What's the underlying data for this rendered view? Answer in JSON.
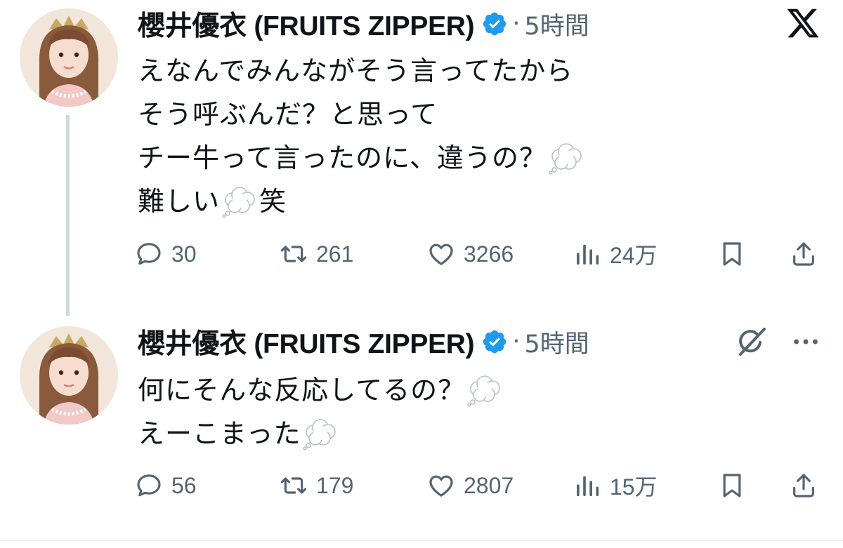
{
  "tweets": [
    {
      "author": "櫻井優衣 (FRUITS ZIPPER)",
      "time": "5時間",
      "lines": [
        {
          "text": "えなんでみんながそう言ってたから",
          "emoji_after": false,
          "tail": ""
        },
        {
          "text": "そう呼ぶんだ？と思って",
          "emoji_after": false,
          "tail": ""
        },
        {
          "text": "チー牛って言ったのに、違うの？",
          "emoji_after": true,
          "tail": ""
        },
        {
          "text": "難しい",
          "emoji_after": true,
          "tail": "笑"
        }
      ],
      "stats": {
        "replies": "30",
        "reposts": "261",
        "likes": "3266",
        "views": "24万"
      }
    },
    {
      "author": "櫻井優衣 (FRUITS ZIPPER)",
      "time": "5時間",
      "lines": [
        {
          "text": "何にそんな反応してるの？",
          "emoji_after": true,
          "tail": ""
        },
        {
          "text": "えーこまった",
          "emoji_after": true,
          "tail": ""
        }
      ],
      "stats": {
        "replies": "56",
        "reposts": "179",
        "likes": "2807",
        "views": "15万"
      }
    }
  ],
  "separator": "·",
  "icons": {
    "top_right": "x-logo-icon",
    "second_tweet_right": [
      "grok-icon",
      "more-icon"
    ],
    "emoji": "thought-balloon-icon"
  },
  "colors": {
    "text": "#0f1419",
    "muted": "#536471",
    "verified": "#1d9bf0",
    "thread_line": "#cfd9de"
  }
}
